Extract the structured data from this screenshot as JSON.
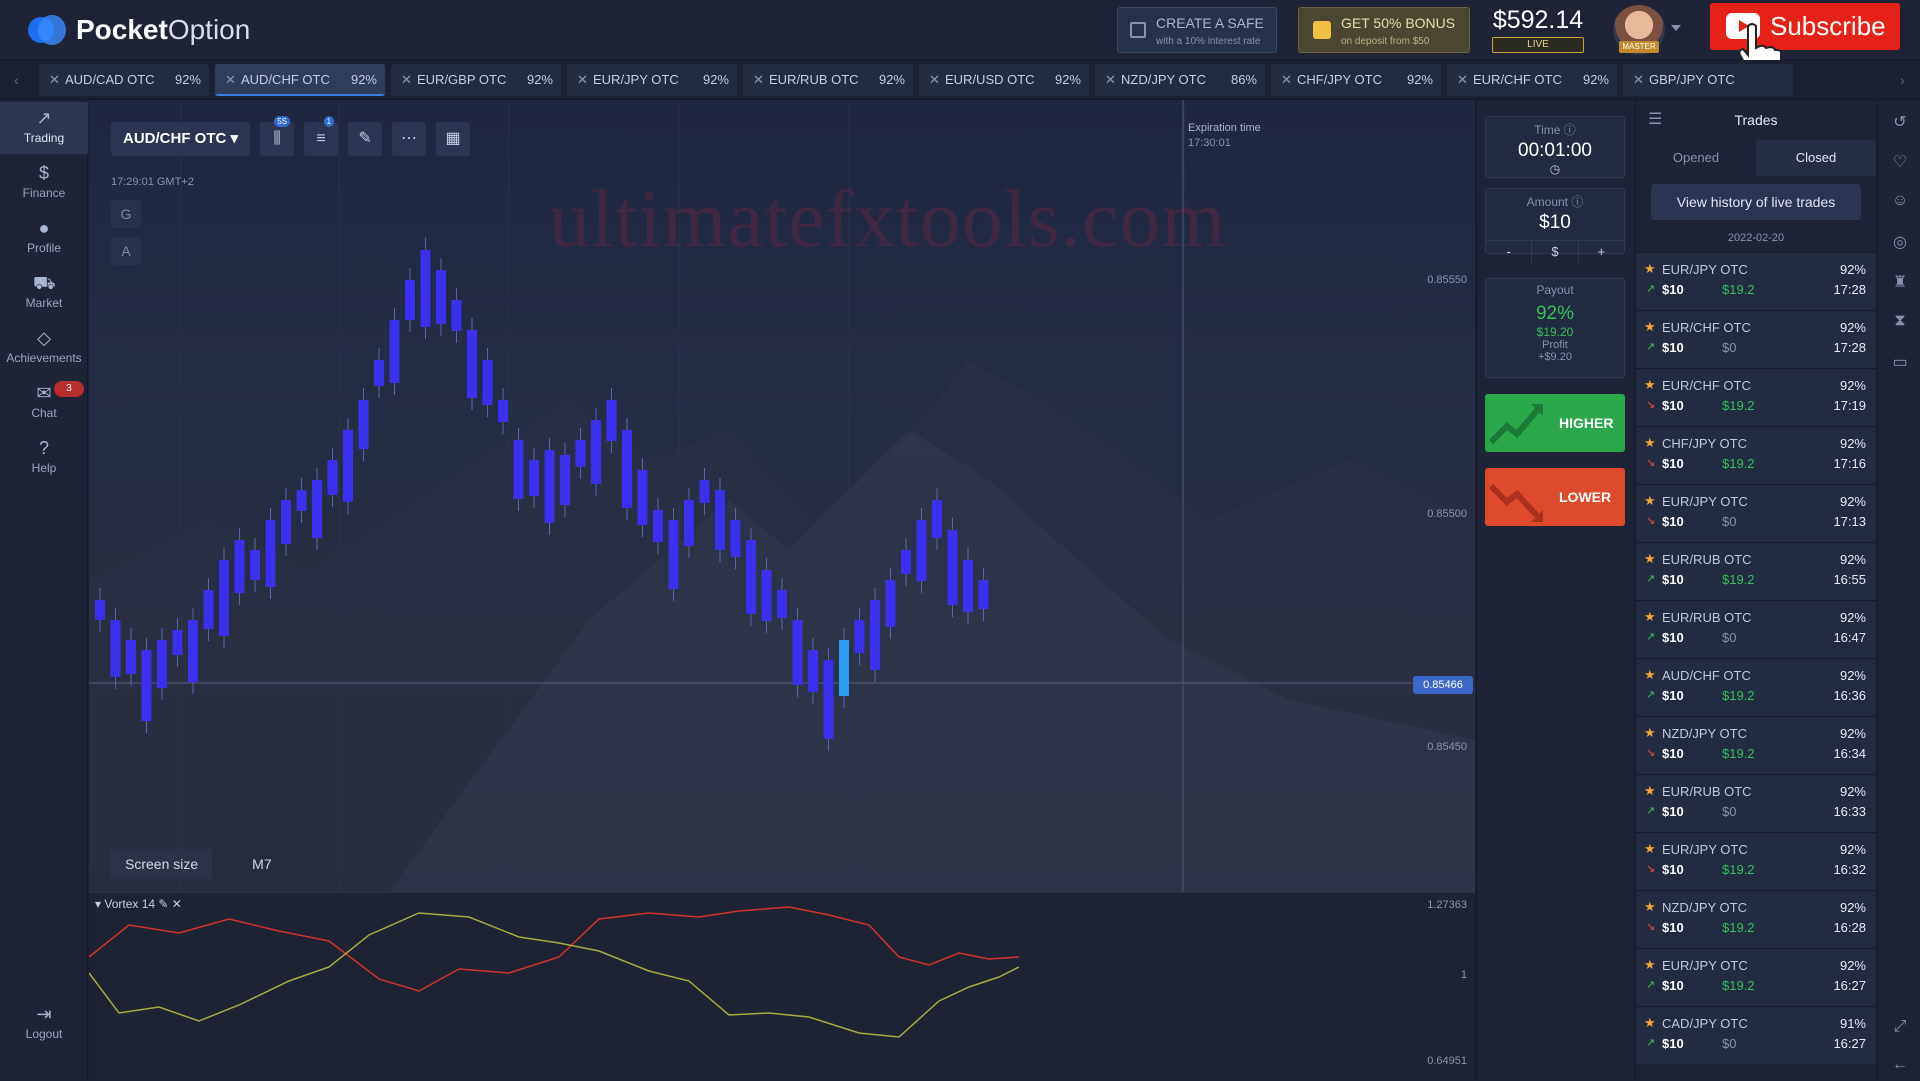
{
  "header": {
    "brand_bold": "Pocket",
    "brand_light": "Option",
    "safe": {
      "title": "CREATE A SAFE",
      "subtitle": "with a 10% interest rate"
    },
    "bonus": {
      "title": "GET 50% BONUS",
      "subtitle": "on deposit from $50"
    },
    "balance": "$592.14",
    "balance_mode": "LIVE",
    "avatar_badge": "MASTER",
    "subscribe_label": "Subscribe"
  },
  "tabs": [
    {
      "pair": "AUD/CAD OTC",
      "payout": "92%"
    },
    {
      "pair": "AUD/CHF OTC",
      "payout": "92%"
    },
    {
      "pair": "EUR/GBP OTC",
      "payout": "92%"
    },
    {
      "pair": "EUR/JPY OTC",
      "payout": "92%"
    },
    {
      "pair": "EUR/RUB OTC",
      "payout": "92%"
    },
    {
      "pair": "EUR/USD OTC",
      "payout": "92%"
    },
    {
      "pair": "NZD/JPY OTC",
      "payout": "86%"
    },
    {
      "pair": "CHF/JPY OTC",
      "payout": "92%"
    },
    {
      "pair": "EUR/CHF OTC",
      "payout": "92%"
    },
    {
      "pair": "GBP/JPY OTC",
      "payout": ""
    }
  ],
  "nav": [
    {
      "label": "Trading",
      "icon": "chart-line-icon"
    },
    {
      "label": "Finance",
      "icon": "dollar-icon"
    },
    {
      "label": "Profile",
      "icon": "user-icon"
    },
    {
      "label": "Market",
      "icon": "cart-icon"
    },
    {
      "label": "Achievements",
      "icon": "diamond-icon"
    },
    {
      "label": "Chat",
      "icon": "chat-icon",
      "badge": "3"
    },
    {
      "label": "Help",
      "icon": "help-icon"
    },
    {
      "label": "Logout",
      "icon": "logout-icon"
    }
  ],
  "chart": {
    "symbol": "AUD/CHF OTC",
    "timeframe_badge": "5S",
    "indicator_badge": "1",
    "server_time": "17:29:01 GMT+2",
    "watermark": "ultimatefxtools.com",
    "expiration_label": "Expiration time",
    "expiration_time": "17:30:01",
    "price_levels": [
      "0.85550",
      "0.85500",
      "0.85450"
    ],
    "current_price": "0.85466",
    "screen_size_label": "Screen size",
    "screen_size_value": "M7",
    "side_buttons": [
      "G",
      "A"
    ]
  },
  "indicator": {
    "name": "Vortex 14",
    "levels": [
      "1.27363",
      "1",
      "0.64951"
    ]
  },
  "trade_panel": {
    "time_label": "Time",
    "time_value": "00:01:00",
    "amount_label": "Amount",
    "amount_value": "$10",
    "amount_minus": "-",
    "amount_currency": "$",
    "amount_plus": "+",
    "payout_label": "Payout",
    "payout_pct": "92%",
    "payout_money": "$19.20",
    "profit_label": "Profit",
    "profit_value": "+$9.20",
    "higher_label": "HIGHER",
    "lower_label": "LOWER"
  },
  "trades": {
    "title": "Trades",
    "tab_opened": "Opened",
    "tab_closed": "Closed",
    "history_button": "View history of live trades",
    "date": "2022-02-20",
    "rows": [
      {
        "pair": "EUR/JPY OTC",
        "payout": "92%",
        "amount": "$10",
        "result": "$19.2",
        "time": "17:28",
        "dir": "up",
        "win": true
      },
      {
        "pair": "EUR/CHF OTC",
        "payout": "92%",
        "amount": "$10",
        "result": "$0",
        "time": "17:28",
        "dir": "up",
        "win": false
      },
      {
        "pair": "EUR/CHF OTC",
        "payout": "92%",
        "amount": "$10",
        "result": "$19.2",
        "time": "17:19",
        "dir": "down",
        "win": true
      },
      {
        "pair": "CHF/JPY OTC",
        "payout": "92%",
        "amount": "$10",
        "result": "$19.2",
        "time": "17:16",
        "dir": "down",
        "win": true
      },
      {
        "pair": "EUR/JPY OTC",
        "payout": "92%",
        "amount": "$10",
        "result": "$0",
        "time": "17:13",
        "dir": "down",
        "win": false
      },
      {
        "pair": "EUR/RUB OTC",
        "payout": "92%",
        "amount": "$10",
        "result": "$19.2",
        "time": "16:55",
        "dir": "up",
        "win": true
      },
      {
        "pair": "EUR/RUB OTC",
        "payout": "92%",
        "amount": "$10",
        "result": "$0",
        "time": "16:47",
        "dir": "up",
        "win": false
      },
      {
        "pair": "AUD/CHF OTC",
        "payout": "92%",
        "amount": "$10",
        "result": "$19.2",
        "time": "16:36",
        "dir": "up",
        "win": true
      },
      {
        "pair": "NZD/JPY OTC",
        "payout": "92%",
        "amount": "$10",
        "result": "$19.2",
        "time": "16:34",
        "dir": "down",
        "win": true
      },
      {
        "pair": "EUR/RUB OTC",
        "payout": "92%",
        "amount": "$10",
        "result": "$0",
        "time": "16:33",
        "dir": "up",
        "win": false
      },
      {
        "pair": "EUR/JPY OTC",
        "payout": "92%",
        "amount": "$10",
        "result": "$19.2",
        "time": "16:32",
        "dir": "down",
        "win": true
      },
      {
        "pair": "NZD/JPY OTC",
        "payout": "92%",
        "amount": "$10",
        "result": "$19.2",
        "time": "16:28",
        "dir": "down",
        "win": true
      },
      {
        "pair": "EUR/JPY OTC",
        "payout": "92%",
        "amount": "$10",
        "result": "$19.2",
        "time": "16:27",
        "dir": "up",
        "win": true
      },
      {
        "pair": "CAD/JPY OTC",
        "payout": "91%",
        "amount": "$10",
        "result": "$0",
        "time": "16:27",
        "dir": "up",
        "win": false
      }
    ]
  },
  "colors": {
    "win": "#35c25a",
    "loss": "#8793ae",
    "candle": "#3b2ff0",
    "accent": "#3d7de0"
  }
}
